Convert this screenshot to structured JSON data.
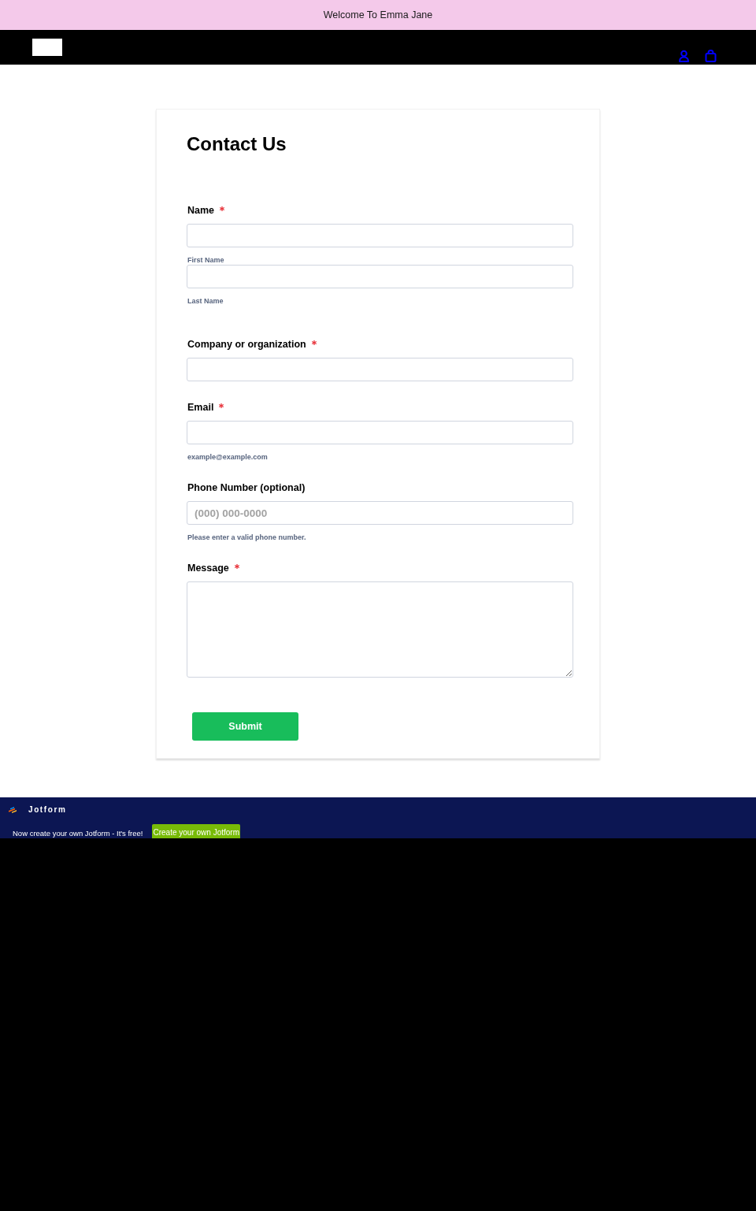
{
  "announcement": "Welcome To Emma Jane",
  "form": {
    "title": "Contact Us",
    "fields": [
      {
        "kind": "name",
        "label": "Name",
        "required": true,
        "inputs": [
          {
            "sublabel": "First Name"
          },
          {
            "sublabel": "Last Name"
          }
        ]
      },
      {
        "kind": "input",
        "label": "Company or organization",
        "required": true
      },
      {
        "kind": "input",
        "label": "Email",
        "required": true,
        "sublabel": "example@example.com"
      },
      {
        "kind": "input",
        "label": "Phone Number (optional)",
        "required": false,
        "placeholder": "(000) 000-0000",
        "sublabel": "Please enter a valid phone number."
      },
      {
        "kind": "textarea",
        "label": "Message",
        "required": true
      }
    ],
    "submit": "Submit"
  },
  "footer": {
    "brand": "Jotform",
    "text": "Now create your own Jotform - It's free!",
    "button": "Create your own Jotform"
  }
}
